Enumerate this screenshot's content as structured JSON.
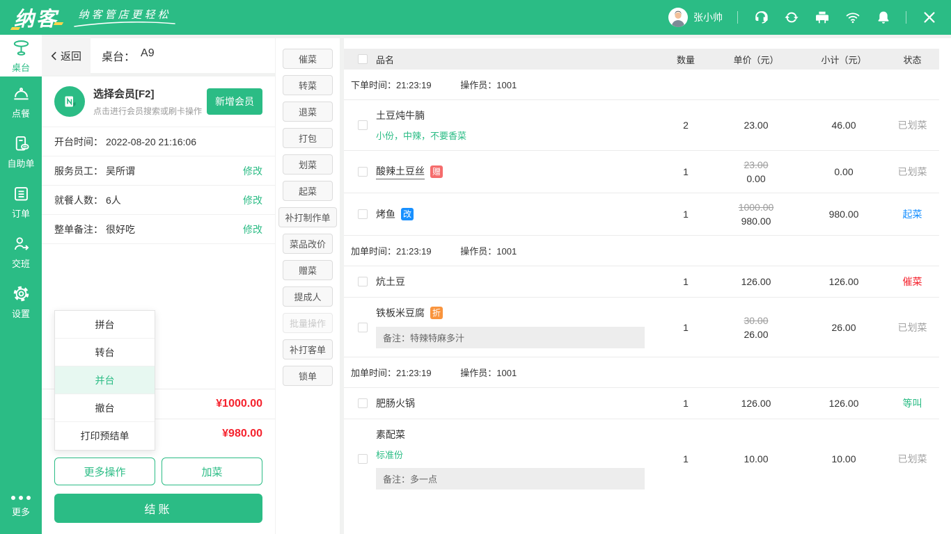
{
  "colors": {
    "brand_green": "#2bbc85",
    "price_red": "#f5222d",
    "status_blue": "#1890ff",
    "badge_gift_red": "#f56c6c",
    "badge_mod_blue": "#1890ff",
    "badge_discount_orange": "#f9943d"
  },
  "topbar": {
    "logo": "纳客",
    "tagline": "纳客管店更轻松",
    "user": "张小帅"
  },
  "sidebar": {
    "items": [
      {
        "label": "桌台"
      },
      {
        "label": "点餐"
      },
      {
        "label": "自助单"
      },
      {
        "label": "订单"
      },
      {
        "label": "交班"
      },
      {
        "label": "设置"
      }
    ],
    "more": "更多"
  },
  "panel": {
    "back": "返回",
    "title_label": "桌台：",
    "table_no": "A9",
    "member": {
      "title": "选择会员[F2]",
      "subtitle": "点击进行会员搜索或刷卡操作",
      "add_button": "新增会员"
    },
    "info": [
      {
        "label": "开台时间：",
        "value": "2022-08-20 21:16:06"
      },
      {
        "label": "服务员工：",
        "value": "吴所谓",
        "action": "修改"
      },
      {
        "label": "就餐人数：",
        "value": "6人",
        "action": "修改"
      },
      {
        "label": "整单备注：",
        "value": "很好吃",
        "action": "修改"
      }
    ],
    "menu": {
      "items": [
        "拼台",
        "转台",
        "并台",
        "撤台",
        "打印预结单"
      ],
      "active": "并台"
    },
    "totals": [
      {
        "amount": "¥1000.00"
      },
      {
        "amount": "¥980.00"
      }
    ],
    "more_button": "更多操作",
    "add_button": "加菜",
    "checkout_button": "结账"
  },
  "actions": [
    {
      "label": "催菜"
    },
    {
      "label": "转菜"
    },
    {
      "label": "退菜"
    },
    {
      "label": "打包"
    },
    {
      "label": "划菜"
    },
    {
      "label": "起菜"
    },
    {
      "label": "补打制作单"
    },
    {
      "label": "菜品改价"
    },
    {
      "label": "赠菜"
    },
    {
      "label": "提成人"
    },
    {
      "label": "批量操作",
      "disabled": true
    },
    {
      "label": "补打客单"
    },
    {
      "label": "锁单"
    }
  ],
  "order": {
    "headers": {
      "name": "品名",
      "qty": "数量",
      "price": "单价（元）",
      "subtotal": "小计（元）",
      "status": "状态"
    },
    "groups": [
      {
        "time_label": "下单时间：",
        "time": "21:23:19",
        "op_label": "操作员：",
        "operator": "1001",
        "items": [
          {
            "name": "土豆炖牛腩",
            "spec": "小份，中辣，不要香菜",
            "qty": "2",
            "price": "23.00",
            "subtotal": "46.00",
            "status": "已划菜"
          },
          {
            "name": "酸辣土豆丝",
            "badge": "赠",
            "qty": "1",
            "old_price": "23.00",
            "price": "0.00",
            "subtotal": "0.00",
            "status": "已划菜"
          },
          {
            "name": "烤鱼",
            "badge": "改",
            "qty": "1",
            "old_price": "1000.00",
            "price": "980.00",
            "subtotal": "980.00",
            "status": "起菜"
          }
        ]
      },
      {
        "time_label": "加单时间：",
        "time": "21:23:19",
        "op_label": "操作员：",
        "operator": "1001",
        "items": [
          {
            "name": "炕土豆",
            "qty": "1",
            "price": "126.00",
            "subtotal": "126.00",
            "status": "催菜"
          },
          {
            "name": "铁板米豆腐",
            "badge": "折",
            "note": "备注：特辣特麻多汁",
            "qty": "1",
            "old_price": "30.00",
            "price": "26.00",
            "subtotal": "26.00",
            "status": "已划菜"
          }
        ]
      },
      {
        "time_label": "加单时间：",
        "time": "21:23:19",
        "op_label": "操作员：",
        "operator": "1001",
        "items": [
          {
            "name": "肥肠火锅",
            "qty": "1",
            "price": "126.00",
            "subtotal": "126.00",
            "status": "等叫"
          },
          {
            "name": "素配菜",
            "spec": "标准份",
            "note": "备注：多一点",
            "qty": "1",
            "price": "10.00",
            "subtotal": "10.00",
            "status": "已划菜"
          }
        ]
      }
    ]
  }
}
